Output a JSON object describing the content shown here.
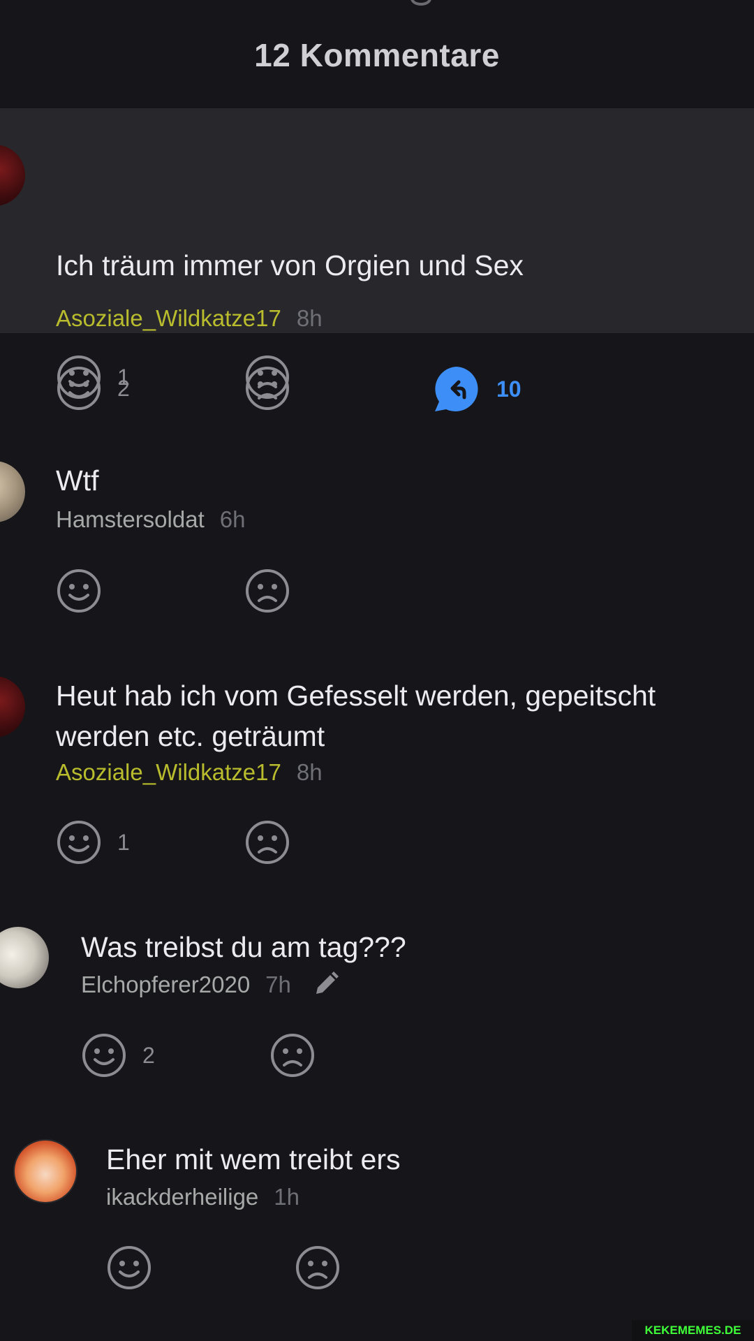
{
  "header": {
    "title": "12 Kommentare"
  },
  "comments": [
    {
      "text": "Ich träum immer von Orgien und Sex",
      "author": "Asoziale_Wildkatze17",
      "time": "8h",
      "likes": "2",
      "replies": "10"
    },
    {
      "likes": "1"
    },
    {
      "text": "Wtf",
      "author": "Hamstersoldat",
      "time": "6h"
    },
    {
      "text_line1": "Heut hab ich vom Gefesselt werden, gepeitscht",
      "text_line2": "werden etc. geträumt",
      "author": "Asoziale_Wildkatze17",
      "time": "8h",
      "likes": "1"
    },
    {
      "text": "Was treibst du am tag???",
      "author": "Elchopferer2020",
      "time": "7h",
      "likes": "2"
    },
    {
      "text": "Eher mit wem treibt ers",
      "author": "ikackderheilige",
      "time": "1h"
    }
  ],
  "watermark": "KEKEMEMES.DE",
  "colors": {
    "background": "#16161a",
    "highlight_row": "#27272c",
    "highlight_author": "#b9bd2d",
    "reply_blue": "#3d8ff7"
  }
}
